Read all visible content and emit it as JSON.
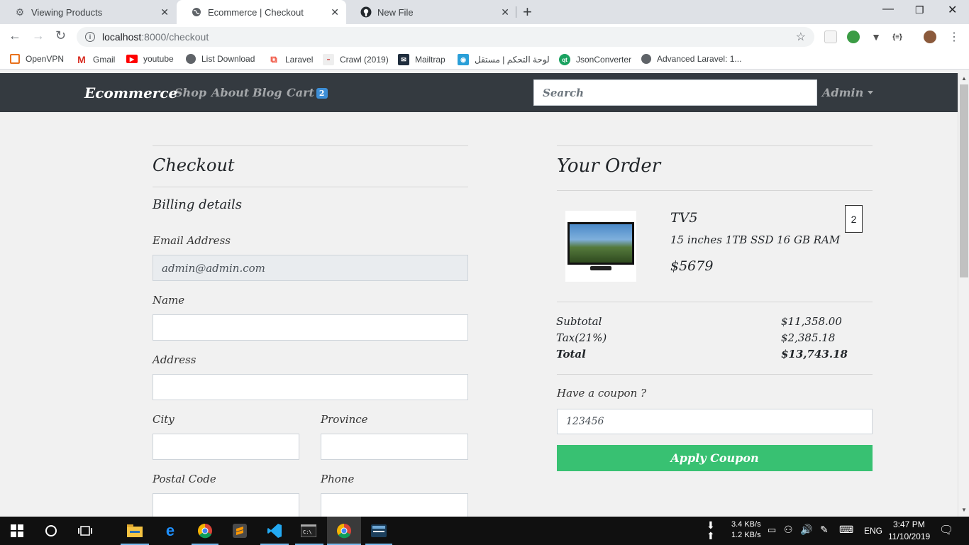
{
  "browser": {
    "tabs": [
      {
        "title": "Viewing Products",
        "icon": "gear-icon"
      },
      {
        "title": "Ecommerce | Checkout",
        "icon": "globe-icon"
      },
      {
        "title": "New File",
        "icon": "github-icon"
      }
    ],
    "url_host": "localhost",
    "url_rest": ":8000/checkout",
    "bookmarks": [
      "OpenVPN",
      "Gmail",
      "youtube",
      "List Download",
      "Laravel",
      "Crawl (2019)",
      "Mailtrap",
      "لوحة التحكم | مستقل",
      "JsonConverter",
      "Advanced Laravel: 1..."
    ]
  },
  "site": {
    "brand": "Ecommerce",
    "nav": [
      "Shop",
      "About",
      "Blog",
      "Cart"
    ],
    "cart_count": "2",
    "search_placeholder": "Search",
    "user": "Admin"
  },
  "checkout": {
    "title": "Checkout",
    "billing_title": "Billing details",
    "email_label": "Email Address",
    "email_value": "admin@admin.com",
    "name_label": "Name",
    "address_label": "Address",
    "city_label": "City",
    "province_label": "Province",
    "postal_label": "Postal Code",
    "phone_label": "Phone"
  },
  "order": {
    "title": "Your Order",
    "product": {
      "name": "TV5",
      "description": "15 inches 1TB SSD 16 GB RAM",
      "price": "$5679",
      "quantity": "2"
    },
    "subtotal_label": "Subtotal",
    "subtotal": "$11,358.00",
    "tax_label": "Tax(21%)",
    "tax": "$2,385.18",
    "total_label": "Total",
    "total": "$13,743.18",
    "coupon_label": "Have a coupon ?",
    "coupon_value": "123456",
    "apply_label": "Apply Coupon"
  },
  "taskbar": {
    "net_down": "3.4 KB/s",
    "net_up": "1.2 KB/s",
    "lang": "ENG",
    "time": "3:47 PM",
    "date": "11/10/2019"
  },
  "colors": {
    "navbar": "#343a40",
    "apply_button": "#38c172",
    "cart_badge": "#3d8ed6"
  }
}
